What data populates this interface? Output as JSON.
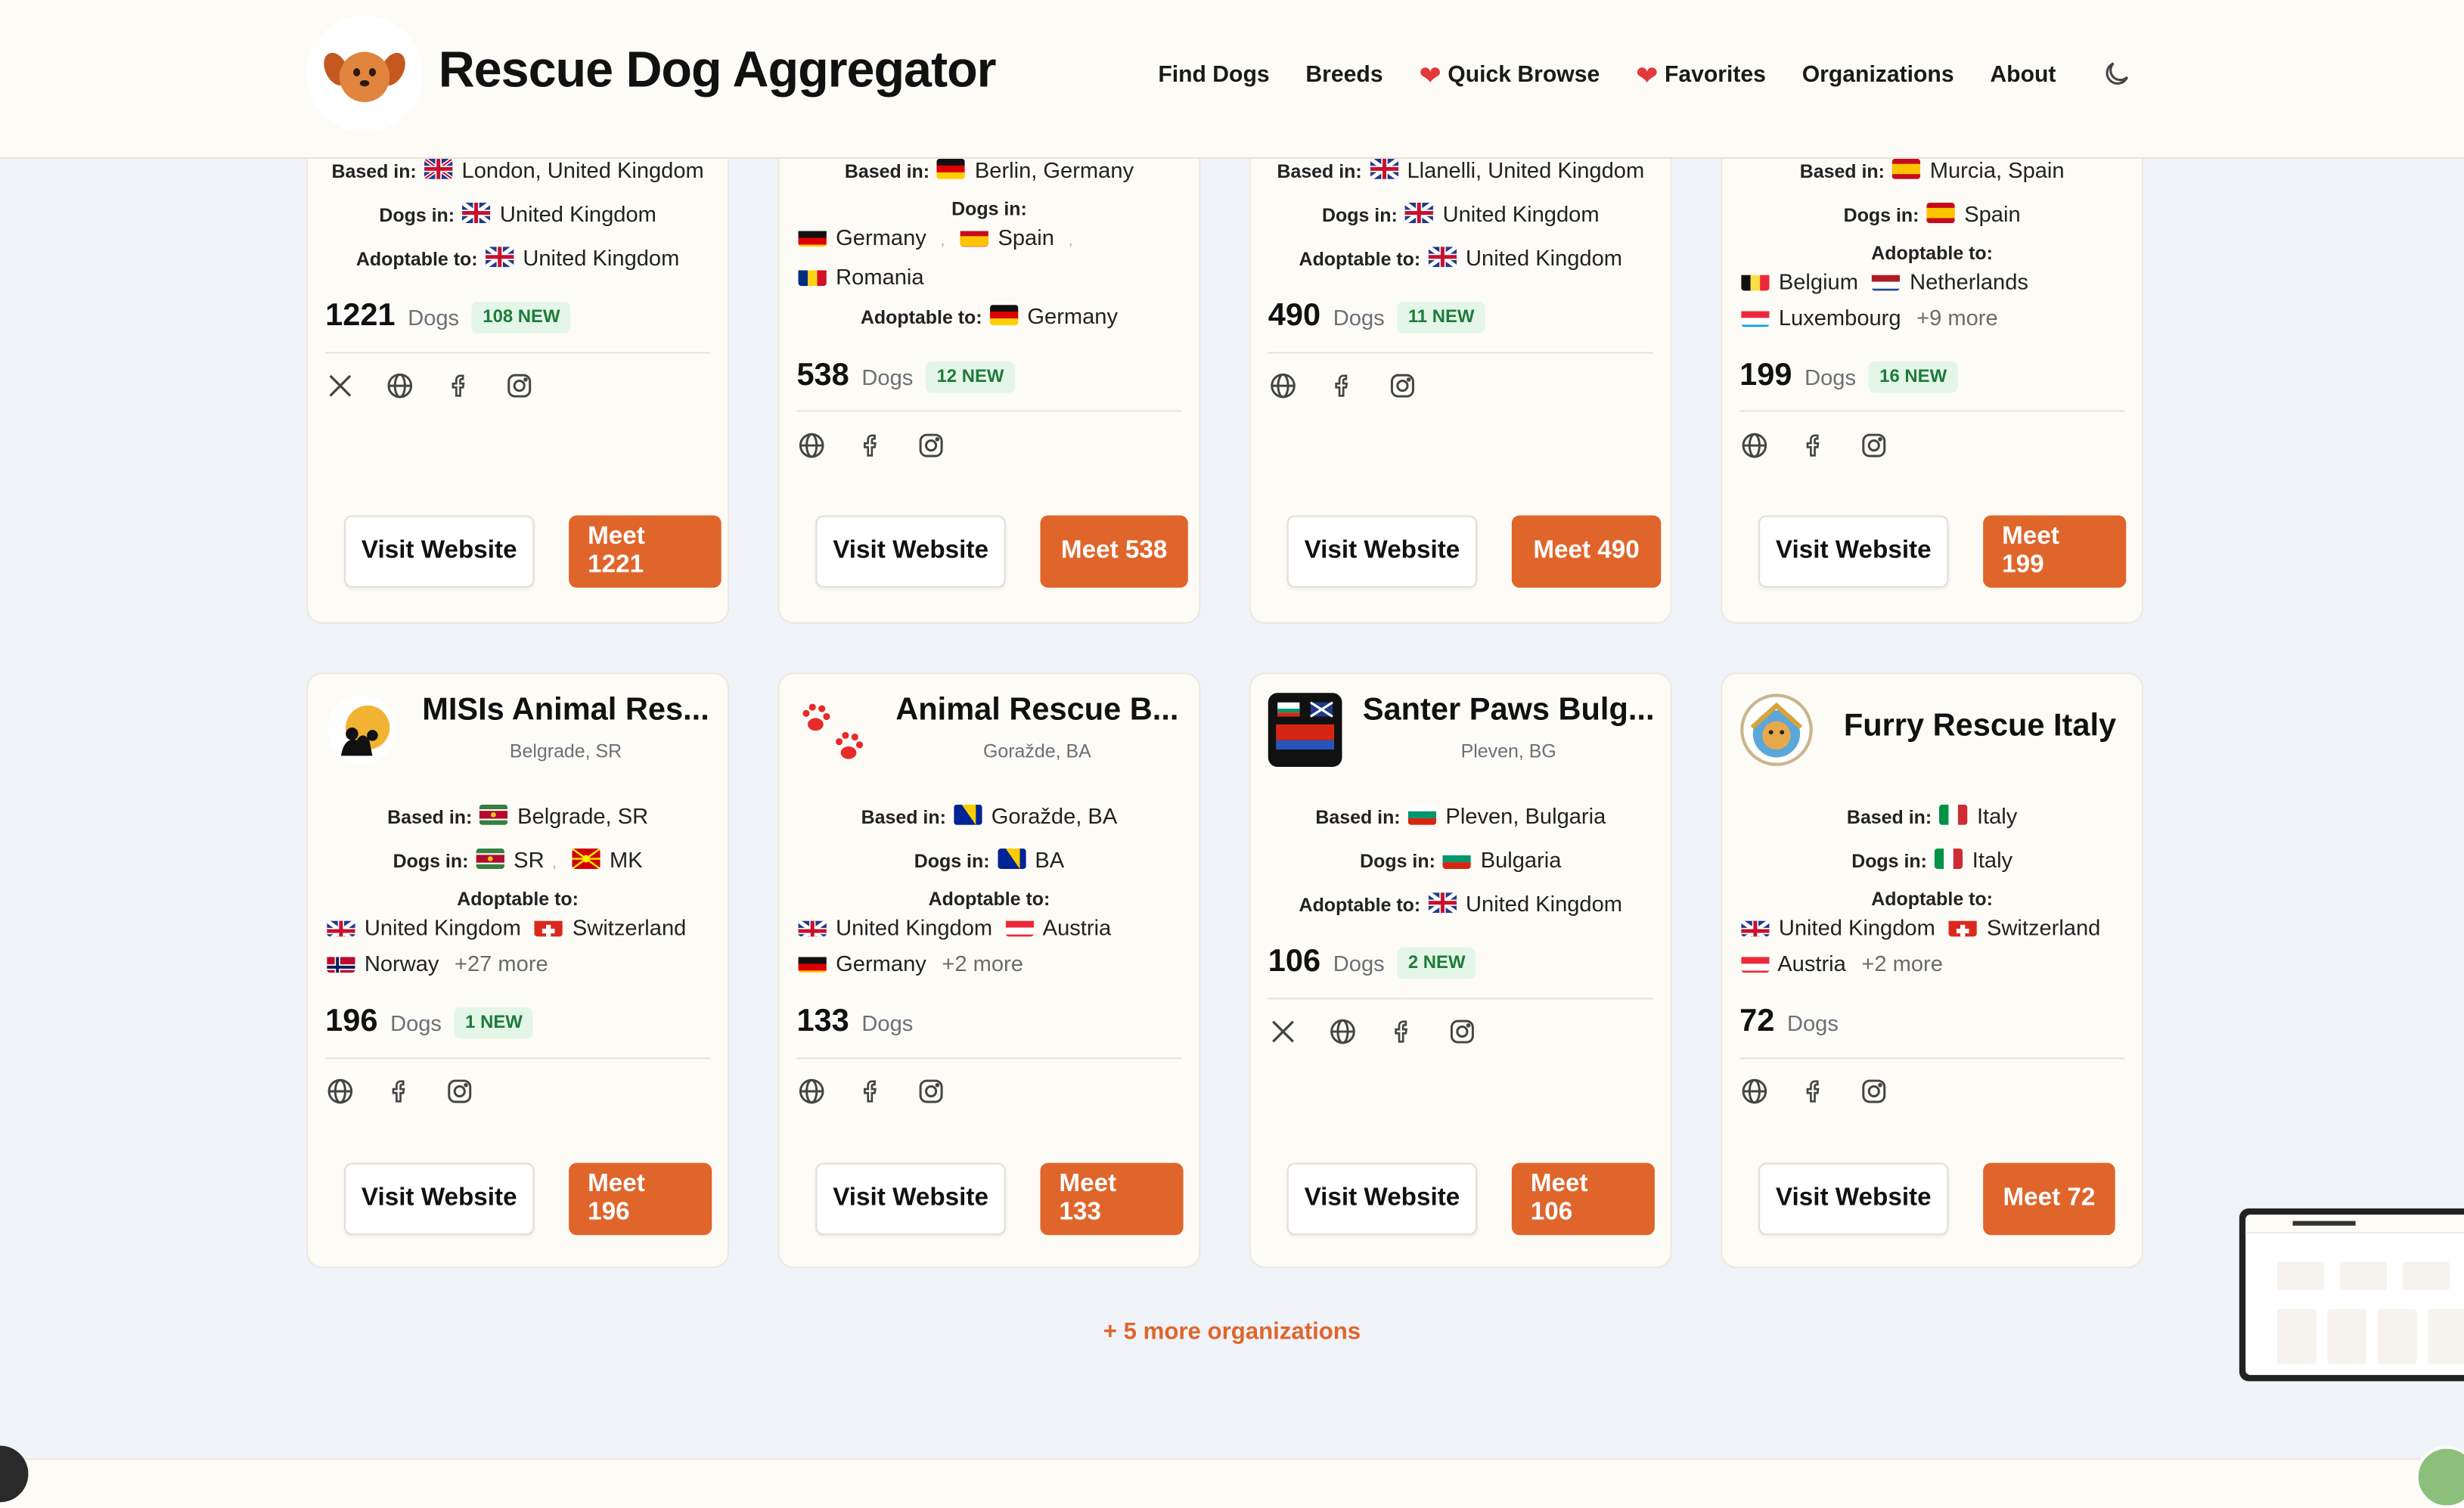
{
  "header": {
    "title": "Rescue Dog Aggregator",
    "nav": [
      "Find Dogs",
      "Breeds",
      "Quick Browse",
      "Favorites",
      "Organizations",
      "About"
    ],
    "logo_icon": "dog-face-icon",
    "theme_icon": "moon-icon",
    "accent": "#e0652b"
  },
  "labels": {
    "based_in": "Based in:",
    "dogs_in": "Dogs in:",
    "adoptable_to": "Adoptable to:",
    "dogs": "Dogs",
    "visit": "Visit Website"
  },
  "cards": [
    {
      "based_in": "London, United Kingdom",
      "dogs_in": [
        "United Kingdom"
      ],
      "adoptable_to": [
        "United Kingdom"
      ],
      "count": "1221",
      "new": "108 NEW",
      "meet": "Meet 1221"
    },
    {
      "based_in": "Berlin, Germany",
      "dogs_in": [
        "Germany",
        "Spain",
        "Romania"
      ],
      "adoptable_to": [
        "Germany"
      ],
      "count": "538",
      "new": "12 NEW",
      "meet": "Meet 538"
    },
    {
      "based_in": "Llanelli, United Kingdom",
      "dogs_in": [
        "United Kingdom"
      ],
      "adoptable_to": [
        "United Kingdom"
      ],
      "count": "490",
      "new": "11 NEW",
      "meet": "Meet 490"
    },
    {
      "based_in": "Murcia, Spain",
      "dogs_in": [
        "Spain"
      ],
      "adoptable_to": [
        "Belgium",
        "Netherlands",
        "Luxembourg"
      ],
      "adoptable_more": "+9 more",
      "count": "199",
      "new": "16 NEW",
      "meet": "Meet 199"
    },
    {
      "name": "MISIs Animal Res...",
      "location": "Belgrade, SR",
      "based_in": "Belgrade, SR",
      "dogs_in": [
        "SR",
        "MK"
      ],
      "adoptable_to": [
        "United Kingdom",
        "Switzerland",
        "Norway"
      ],
      "adoptable_more": "+27 more",
      "count": "196",
      "new": "1 NEW",
      "meet": "Meet 196"
    },
    {
      "name": "Animal Rescue B...",
      "location": "Goražde, BA",
      "based_in": "Goražde, BA",
      "dogs_in": [
        "BA"
      ],
      "adoptable_to": [
        "United Kingdom",
        "Austria",
        "Germany"
      ],
      "adoptable_more": "+2 more",
      "count": "133",
      "meet": "Meet 133"
    },
    {
      "name": "Santer Paws Bulg...",
      "location": "Pleven, BG",
      "based_in": "Pleven, Bulgaria",
      "dogs_in": [
        "Bulgaria"
      ],
      "adoptable_to": [
        "United Kingdom"
      ],
      "count": "106",
      "new": "2 NEW",
      "meet": "Meet 106"
    },
    {
      "name": "Furry Rescue Italy",
      "based_in": "Italy",
      "dogs_in": [
        "Italy"
      ],
      "adoptable_to": [
        "United Kingdom",
        "Switzerland",
        "Austria"
      ],
      "adoptable_more": "+2 more",
      "count": "72",
      "meet": "Meet 72"
    }
  ],
  "more_orgs": "+ 5 more organizations"
}
